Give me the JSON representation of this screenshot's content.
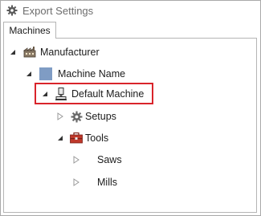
{
  "window": {
    "title": "Export Settings"
  },
  "tabs": [
    {
      "label": "Machines",
      "active": true
    }
  ],
  "tree": {
    "manufacturer": {
      "label": "Manufacturer",
      "expanded": true,
      "icon": "factory-icon"
    },
    "machine_name": {
      "label": "Machine Name",
      "expanded": true,
      "icon": "blue-square-icon"
    },
    "default_machine": {
      "label": "Default Machine",
      "expanded": true,
      "icon": "machine-icon",
      "highlighted": true
    },
    "setups": {
      "label": "Setups",
      "expanded": false,
      "icon": "gear-icon"
    },
    "tools": {
      "label": "Tools",
      "expanded": true,
      "icon": "toolbox-icon"
    },
    "saws": {
      "label": "Saws",
      "expanded": false
    },
    "mills": {
      "label": "Mills",
      "expanded": false
    }
  },
  "colors": {
    "highlight": "#d9242b",
    "blue_square": "#7f9cc4",
    "toolbox": "#c0392b"
  }
}
